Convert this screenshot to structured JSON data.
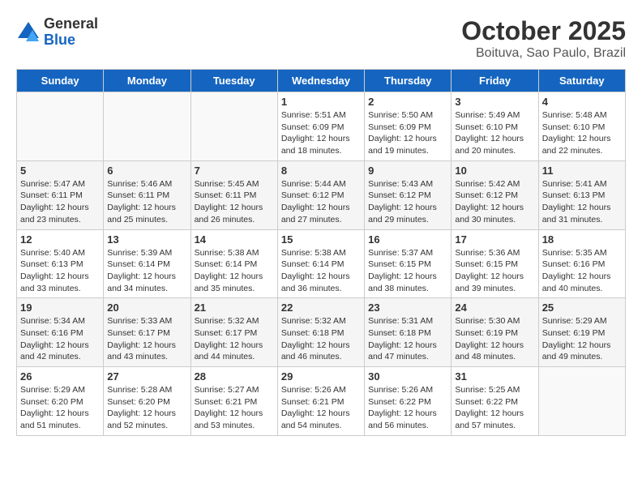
{
  "logo": {
    "general": "General",
    "blue": "Blue"
  },
  "title": "October 2025",
  "location": "Boituva, Sao Paulo, Brazil",
  "days_of_week": [
    "Sunday",
    "Monday",
    "Tuesday",
    "Wednesday",
    "Thursday",
    "Friday",
    "Saturday"
  ],
  "weeks": [
    [
      {
        "day": "",
        "info": ""
      },
      {
        "day": "",
        "info": ""
      },
      {
        "day": "",
        "info": ""
      },
      {
        "day": "1",
        "info": "Sunrise: 5:51 AM\nSunset: 6:09 PM\nDaylight: 12 hours\nand 18 minutes."
      },
      {
        "day": "2",
        "info": "Sunrise: 5:50 AM\nSunset: 6:09 PM\nDaylight: 12 hours\nand 19 minutes."
      },
      {
        "day": "3",
        "info": "Sunrise: 5:49 AM\nSunset: 6:10 PM\nDaylight: 12 hours\nand 20 minutes."
      },
      {
        "day": "4",
        "info": "Sunrise: 5:48 AM\nSunset: 6:10 PM\nDaylight: 12 hours\nand 22 minutes."
      }
    ],
    [
      {
        "day": "5",
        "info": "Sunrise: 5:47 AM\nSunset: 6:11 PM\nDaylight: 12 hours\nand 23 minutes."
      },
      {
        "day": "6",
        "info": "Sunrise: 5:46 AM\nSunset: 6:11 PM\nDaylight: 12 hours\nand 25 minutes."
      },
      {
        "day": "7",
        "info": "Sunrise: 5:45 AM\nSunset: 6:11 PM\nDaylight: 12 hours\nand 26 minutes."
      },
      {
        "day": "8",
        "info": "Sunrise: 5:44 AM\nSunset: 6:12 PM\nDaylight: 12 hours\nand 27 minutes."
      },
      {
        "day": "9",
        "info": "Sunrise: 5:43 AM\nSunset: 6:12 PM\nDaylight: 12 hours\nand 29 minutes."
      },
      {
        "day": "10",
        "info": "Sunrise: 5:42 AM\nSunset: 6:12 PM\nDaylight: 12 hours\nand 30 minutes."
      },
      {
        "day": "11",
        "info": "Sunrise: 5:41 AM\nSunset: 6:13 PM\nDaylight: 12 hours\nand 31 minutes."
      }
    ],
    [
      {
        "day": "12",
        "info": "Sunrise: 5:40 AM\nSunset: 6:13 PM\nDaylight: 12 hours\nand 33 minutes."
      },
      {
        "day": "13",
        "info": "Sunrise: 5:39 AM\nSunset: 6:14 PM\nDaylight: 12 hours\nand 34 minutes."
      },
      {
        "day": "14",
        "info": "Sunrise: 5:38 AM\nSunset: 6:14 PM\nDaylight: 12 hours\nand 35 minutes."
      },
      {
        "day": "15",
        "info": "Sunrise: 5:38 AM\nSunset: 6:14 PM\nDaylight: 12 hours\nand 36 minutes."
      },
      {
        "day": "16",
        "info": "Sunrise: 5:37 AM\nSunset: 6:15 PM\nDaylight: 12 hours\nand 38 minutes."
      },
      {
        "day": "17",
        "info": "Sunrise: 5:36 AM\nSunset: 6:15 PM\nDaylight: 12 hours\nand 39 minutes."
      },
      {
        "day": "18",
        "info": "Sunrise: 5:35 AM\nSunset: 6:16 PM\nDaylight: 12 hours\nand 40 minutes."
      }
    ],
    [
      {
        "day": "19",
        "info": "Sunrise: 5:34 AM\nSunset: 6:16 PM\nDaylight: 12 hours\nand 42 minutes."
      },
      {
        "day": "20",
        "info": "Sunrise: 5:33 AM\nSunset: 6:17 PM\nDaylight: 12 hours\nand 43 minutes."
      },
      {
        "day": "21",
        "info": "Sunrise: 5:32 AM\nSunset: 6:17 PM\nDaylight: 12 hours\nand 44 minutes."
      },
      {
        "day": "22",
        "info": "Sunrise: 5:32 AM\nSunset: 6:18 PM\nDaylight: 12 hours\nand 46 minutes."
      },
      {
        "day": "23",
        "info": "Sunrise: 5:31 AM\nSunset: 6:18 PM\nDaylight: 12 hours\nand 47 minutes."
      },
      {
        "day": "24",
        "info": "Sunrise: 5:30 AM\nSunset: 6:19 PM\nDaylight: 12 hours\nand 48 minutes."
      },
      {
        "day": "25",
        "info": "Sunrise: 5:29 AM\nSunset: 6:19 PM\nDaylight: 12 hours\nand 49 minutes."
      }
    ],
    [
      {
        "day": "26",
        "info": "Sunrise: 5:29 AM\nSunset: 6:20 PM\nDaylight: 12 hours\nand 51 minutes."
      },
      {
        "day": "27",
        "info": "Sunrise: 5:28 AM\nSunset: 6:20 PM\nDaylight: 12 hours\nand 52 minutes."
      },
      {
        "day": "28",
        "info": "Sunrise: 5:27 AM\nSunset: 6:21 PM\nDaylight: 12 hours\nand 53 minutes."
      },
      {
        "day": "29",
        "info": "Sunrise: 5:26 AM\nSunset: 6:21 PM\nDaylight: 12 hours\nand 54 minutes."
      },
      {
        "day": "30",
        "info": "Sunrise: 5:26 AM\nSunset: 6:22 PM\nDaylight: 12 hours\nand 56 minutes."
      },
      {
        "day": "31",
        "info": "Sunrise: 5:25 AM\nSunset: 6:22 PM\nDaylight: 12 hours\nand 57 minutes."
      },
      {
        "day": "",
        "info": ""
      }
    ]
  ]
}
